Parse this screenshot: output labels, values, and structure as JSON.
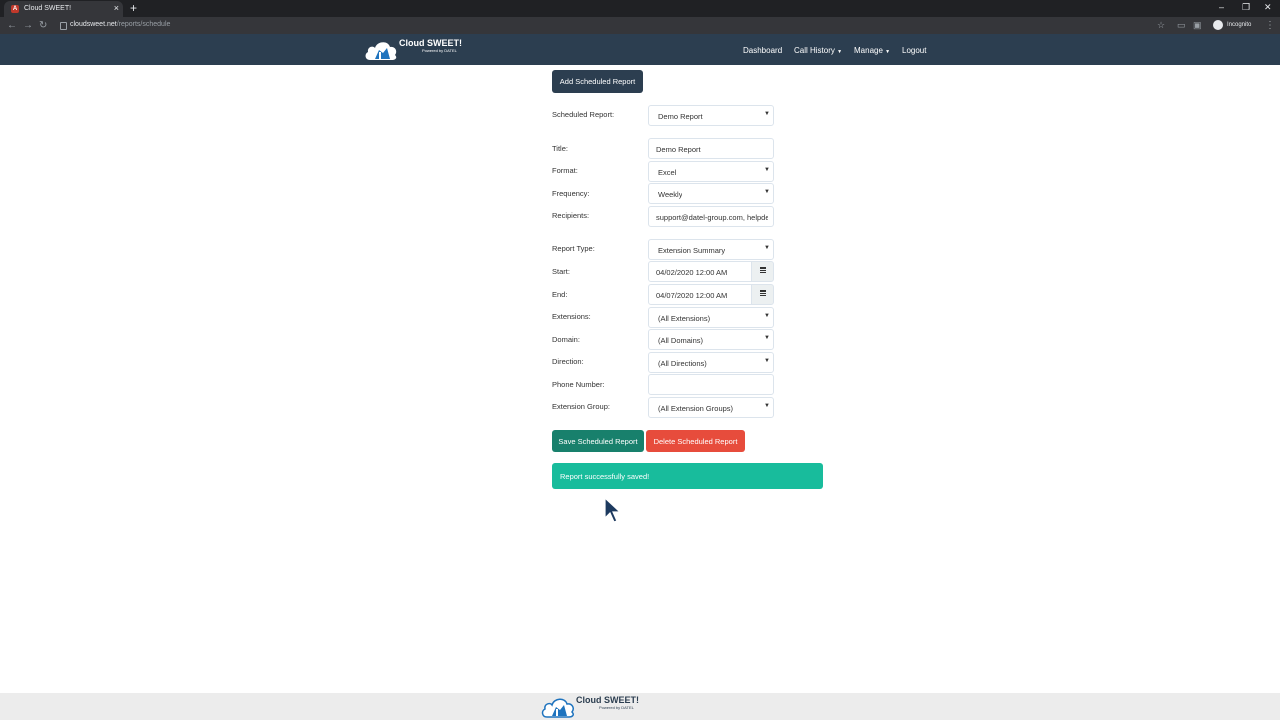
{
  "browser": {
    "tab_title": "Cloud SWEET!",
    "tab_favicon": "A",
    "url_host": "cloudsweet.net",
    "url_path": "/reports/schedule",
    "profile_label": "Incognito"
  },
  "nav": {
    "logo_name": "Cloud SWEET!",
    "logo_sub": "Powered by DATEL",
    "items": [
      "Dashboard",
      "Call History",
      "Manage",
      "Logout"
    ]
  },
  "page": {
    "add_button": "Add Scheduled Report",
    "fields": {
      "scheduled_report": {
        "label": "Scheduled Report:",
        "value": "Demo Report"
      },
      "title": {
        "label": "Title:",
        "value": "Demo Report"
      },
      "format": {
        "label": "Format:",
        "value": "Excel"
      },
      "frequency": {
        "label": "Frequency:",
        "value": "Weekly"
      },
      "recipients": {
        "label": "Recipients:",
        "value": "support@datel-group.com, helpde"
      },
      "report_type": {
        "label": "Report Type:",
        "value": "Extension Summary"
      },
      "start": {
        "label": "Start:",
        "value": "04/02/2020 12:00 AM"
      },
      "end": {
        "label": "End:",
        "value": "04/07/2020 12:00 AM"
      },
      "extensions": {
        "label": "Extensions:",
        "value": "(All Extensions)"
      },
      "domain": {
        "label": "Domain:",
        "value": "(All Domains)"
      },
      "direction": {
        "label": "Direction:",
        "value": "(All Directions)"
      },
      "phone_number": {
        "label": "Phone Number:",
        "value": ""
      },
      "extension_group": {
        "label": "Extension Group:",
        "value": "(All Extension Groups)"
      }
    },
    "save_button": "Save Scheduled Report",
    "delete_button": "Delete Scheduled Report",
    "alert": "Report successfully saved!"
  },
  "colors": {
    "navbar": "#2c3e50",
    "success": "#18bc9c",
    "save_button": "#18806c",
    "danger": "#e74c3c",
    "footer": "#ececec"
  }
}
